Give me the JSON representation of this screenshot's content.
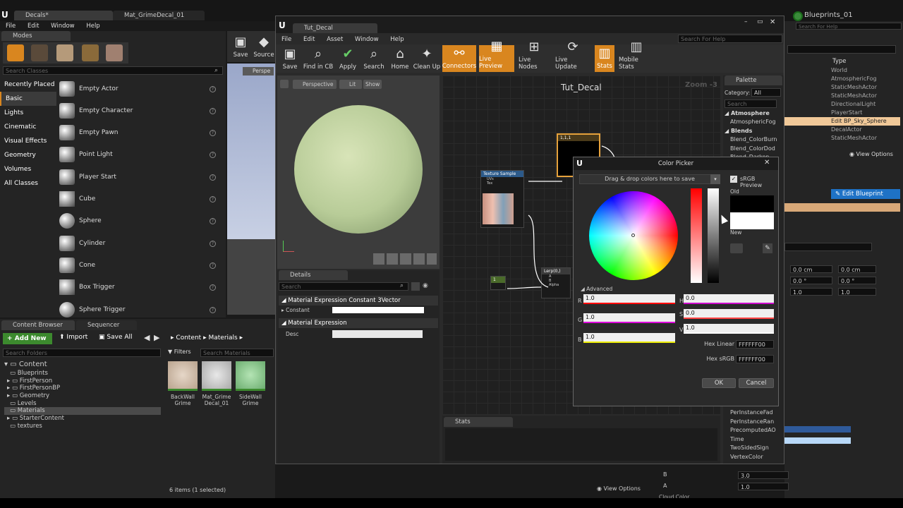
{
  "bg_tabs": {
    "decals": "Decals*",
    "grime_decal": "Mat_GrimeDecal_01"
  },
  "bg_menu": [
    "File",
    "Edit",
    "Window",
    "Help"
  ],
  "modes": {
    "title": "Modes",
    "search_placeholder": "Search Classes",
    "categories": [
      "Recently Placed",
      "Basic",
      "Lights",
      "Cinematic",
      "Visual Effects",
      "Geometry",
      "Volumes",
      "All Classes"
    ],
    "items": [
      "Empty Actor",
      "Empty Character",
      "Empty Pawn",
      "Point Light",
      "Player Start",
      "Cube",
      "Sphere",
      "Cylinder",
      "Cone",
      "Box Trigger",
      "Sphere Trigger"
    ]
  },
  "bg_toolbar": {
    "save": "Save",
    "source": "Source",
    "viewport_mode": "Perspe"
  },
  "content_browser": {
    "tab": "Content Browser",
    "tab2": "Sequencer",
    "add_new": "Add New",
    "import": "Import",
    "save_all": "Save All",
    "breadcrumb": [
      "Content",
      "Materials"
    ],
    "search_folders": "Search Folders",
    "filters": "Filters",
    "search_materials": "Search Materials",
    "tree": [
      "Content",
      "Blueprints",
      "FirstPerson",
      "FirstPersonBP",
      "Geometry",
      "Levels",
      "Materials",
      "StarterContent",
      "textures"
    ],
    "assets": [
      {
        "name": "BackWall Grime"
      },
      {
        "name": "Mat_Grime Decal_01"
      },
      {
        "name": "SideWall Grime"
      }
    ],
    "status": "6 items (1 selected)",
    "view_options": "View Options"
  },
  "right_panel": {
    "title": "Blueprints_01",
    "search_help": "Search For Help",
    "type_header": "Type",
    "types": [
      "World",
      "AtmosphericFog",
      "StaticMeshActor",
      "StaticMeshActor",
      "DirectionalLight",
      "PlayerStart",
      "Edit BP_Sky_Sphere",
      "DecalActor",
      "StaticMeshActor"
    ],
    "view_options": "View Options",
    "edit_blueprint": "Edit Blueprint",
    "loc": [
      "0.0 cm",
      "0.0 cm"
    ],
    "rot": [
      "0.0 °",
      "0.0 °"
    ],
    "scale": [
      "1.0",
      "1.0"
    ],
    "labels_b": "B",
    "labels_a": "A",
    "b_value": "3.0",
    "a_value": "1.0",
    "cloud_color": "Cloud Color"
  },
  "mat_editor": {
    "tab": "Tut_Decal",
    "menu": [
      "File",
      "Edit",
      "Asset",
      "Window",
      "Help"
    ],
    "search_help": "Search For Help",
    "toolbar": [
      "Save",
      "Find in CB",
      "Apply",
      "Search",
      "Home",
      "Clean Up",
      "Connectors",
      "Live Preview",
      "Live Nodes",
      "Live Update",
      "Stats",
      "Mobile Stats"
    ],
    "viewport_buttons": [
      "Perspective",
      "Lit",
      "Show"
    ],
    "graph_title": "Tut_Decal",
    "zoom": "Zoom -3",
    "details_tab": "Details",
    "search_placeholder": "Search",
    "section1": "Material Expression Constant 3Vector",
    "constant_label": "Constant",
    "section2": "Material Expression",
    "desc_label": "Desc",
    "stats_tab": "Stats",
    "node_texture": "Texture Sample",
    "node_texture_pins": [
      "UVs",
      "Tex"
    ],
    "node_const": "1,1,1",
    "node_lerp": "Lerp(0,)",
    "node_lerp_pins": [
      "A",
      "B",
      "Alpha"
    ],
    "node_one": "1"
  },
  "palette": {
    "tab": "Palette",
    "category_label": "Category:",
    "category_value": "All",
    "search_placeholder": "Search",
    "items": [
      "Atmosphere",
      "AtmosphericFog",
      "Blends",
      "Blend_ColorBurn",
      "Blend_ColorDod",
      "Blend_Darken"
    ],
    "bottom_items": [
      "PerInstanceFad",
      "PerInstanceRan",
      "PrecomputedAO",
      "Time",
      "TwoSidedSign",
      "VertexColor"
    ]
  },
  "color_picker": {
    "title": "Color Picker",
    "drag_text": "Drag & drop colors here to save",
    "srgb_preview": "sRGB Preview",
    "old": "Old",
    "new": "New",
    "advanced": "Advanced",
    "r_label": "R",
    "g_label": "G",
    "b_label": "B",
    "h_label": "H",
    "s_label": "S",
    "v_label": "V",
    "r": "1.0",
    "g": "1.0",
    "b": "1.0",
    "h": "0.0",
    "s": "0.0",
    "v": "1.0",
    "hex_linear_label": "Hex Linear",
    "hex_linear": "FFFFFF00",
    "hex_srgb_label": "Hex sRGB",
    "hex_srgb": "FFFFFF00",
    "ok": "OK",
    "cancel": "Cancel",
    "old_color": "#000000",
    "new_color": "#ffffff"
  },
  "colors": {
    "accent_orange": "#d9861f",
    "accent_blue": "#1e72c6",
    "add_new_green": "#3c8a2e"
  }
}
